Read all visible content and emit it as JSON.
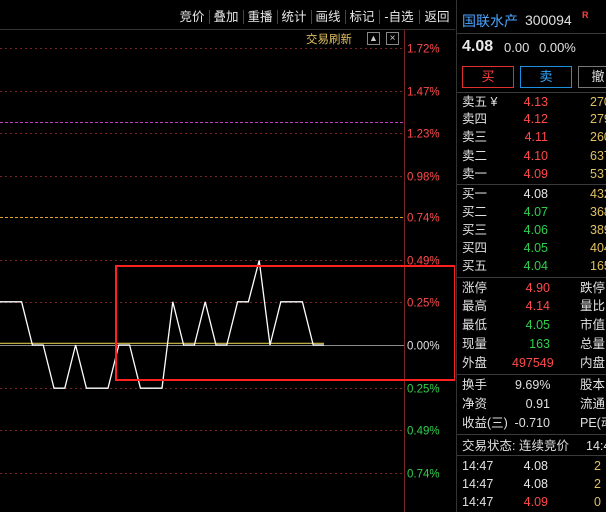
{
  "colors": {
    "up": "#ff4a4a",
    "down": "#2fcf4a",
    "grid": "#7a2525",
    "price_line": "#ffffff",
    "avg_line": "#d4c24a",
    "limit_line_magenta": "#c040c0",
    "limit_line_orange": "#e0a030",
    "highlight_box": "#ff2020"
  },
  "toolbar": {
    "buttons": [
      "竞价",
      "叠加",
      "重播",
      "统计",
      "画线",
      "标记",
      "-自选",
      "返回"
    ]
  },
  "chart": {
    "refresh_label": "交易刷新",
    "up_icon": "▲",
    "close_icon": "×"
  },
  "chart_data": {
    "type": "line",
    "y_tick_labels": [
      "1.72%",
      "1.47%",
      "1.23%",
      "0.98%",
      "0.74%",
      "0.49%",
      "0.25%",
      "0.00%",
      "0.25%",
      "0.49%",
      "0.74%"
    ],
    "y_tick_values": [
      1.72,
      1.47,
      1.23,
      0.98,
      0.74,
      0.49,
      0.25,
      0.0,
      -0.25,
      -0.49,
      -0.74
    ],
    "ylim": [
      -0.8,
      1.78
    ],
    "reference_lines": [
      1.29,
      0.74
    ],
    "series": [
      {
        "values": [
          0.25,
          0.25,
          0.25,
          0.0,
          0.0,
          -0.25,
          -0.25,
          0.0,
          -0.25,
          -0.25,
          -0.25,
          0.0,
          0.0,
          -0.25,
          -0.25,
          -0.25,
          0.25,
          0.0,
          0.0,
          0.25,
          0.0,
          0.0,
          0.25,
          0.25,
          0.49,
          0.0,
          0.25,
          0.25,
          0.25,
          0.0,
          0.0
        ]
      },
      {
        "values": [
          0.01,
          0.01,
          0.01,
          0.01,
          0.01,
          0.01,
          0.01,
          0.01,
          0.01,
          0.01,
          0.01,
          0.01,
          0.01,
          0.01,
          0.01,
          0.01,
          0.01,
          0.01,
          0.01,
          0.01,
          0.01,
          0.01,
          0.01,
          0.01,
          0.01,
          0.01,
          0.01,
          0.01,
          0.01,
          0.01,
          0.01
        ]
      }
    ]
  },
  "stock": {
    "name": "国联水产",
    "code": "300094",
    "badge": "R",
    "price": "4.08",
    "change": "0.00",
    "change_pct": "0.00%"
  },
  "actions": {
    "buy": "买",
    "sell": "卖",
    "cancel": "撤"
  },
  "order_book": {
    "asks": [
      {
        "label": "卖五 ¥",
        "price": "4.13",
        "vol": "270"
      },
      {
        "label": "卖四",
        "price": "4.12",
        "vol": "279"
      },
      {
        "label": "卖三",
        "price": "4.11",
        "vol": "260"
      },
      {
        "label": "卖二",
        "price": "4.10",
        "vol": "637"
      },
      {
        "label": "卖一",
        "price": "4.09",
        "vol": "537"
      }
    ],
    "bids": [
      {
        "label": "买一",
        "price": "4.08",
        "vol": "432"
      },
      {
        "label": "买二",
        "price": "4.07",
        "vol": "368"
      },
      {
        "label": "买三",
        "price": "4.06",
        "vol": "389"
      },
      {
        "label": "买四",
        "price": "4.05",
        "vol": "404"
      },
      {
        "label": "买五",
        "price": "4.04",
        "vol": "165"
      }
    ]
  },
  "quote": {
    "limit_up_label": "涨停",
    "limit_up": "4.90",
    "limit_down_label": "跌停",
    "high_label": "最高",
    "high": "4.14",
    "vol_ratio_label": "量比",
    "low_label": "最低",
    "low": "4.05",
    "mkt_value_label": "市值",
    "current_vol_label": "现量",
    "current_vol": "163",
    "total_vol_label": "总量",
    "outer_label": "外盘",
    "outer": "497549",
    "inner_label": "内盘"
  },
  "fundamentals": {
    "turnover_label": "换手",
    "turnover": "9.69%",
    "share_cap_label": "股本",
    "net_asset_label": "净资",
    "net_asset": "0.91",
    "float_label": "流通",
    "eps_label": "收益(三)",
    "eps": "-0.710",
    "pe_label": "PE(动"
  },
  "trade_status": {
    "label": "交易状态: 连续竞价",
    "time": "14:4"
  },
  "ticks": [
    {
      "time": "14:47",
      "price": "4.08",
      "vol": "2"
    },
    {
      "time": "14:47",
      "price": "4.08",
      "vol": "2"
    },
    {
      "time": "14:47",
      "price": "4.09",
      "vol": "0"
    }
  ]
}
